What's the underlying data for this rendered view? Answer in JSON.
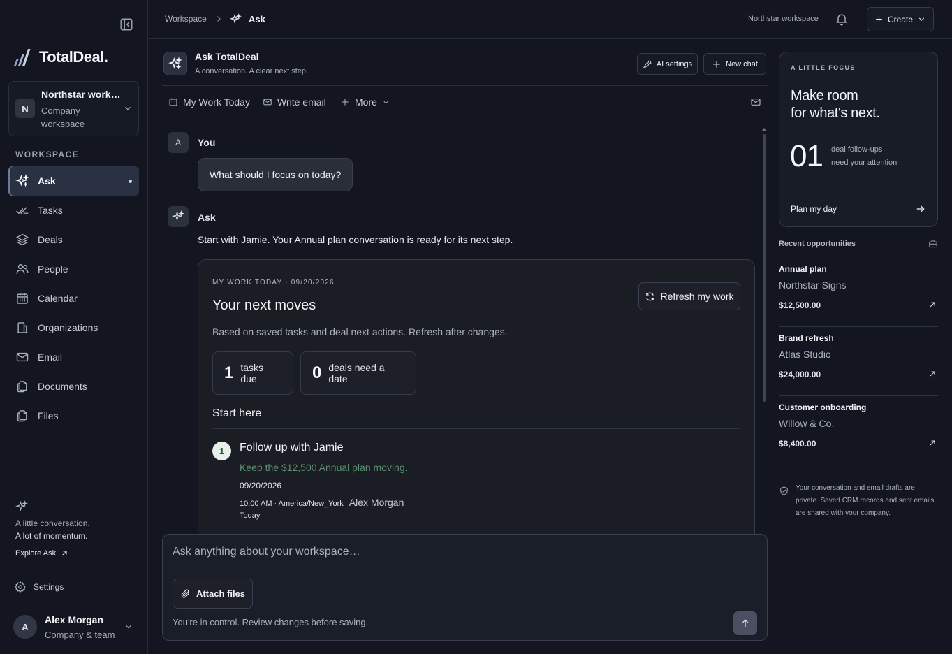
{
  "sidebar": {
    "brand": "TotalDeal.",
    "workspace": {
      "initial": "N",
      "name": "Northstar workspace",
      "type": "Company workspace"
    },
    "section_label": "WORKSPACE",
    "items": [
      {
        "label": "Ask",
        "icon": "sparkle-icon",
        "active": true
      },
      {
        "label": "Tasks",
        "icon": "double-check-icon"
      },
      {
        "label": "Deals",
        "icon": "layers-icon"
      },
      {
        "label": "People",
        "icon": "people-icon"
      },
      {
        "label": "Calendar",
        "icon": "calendar-icon"
      },
      {
        "label": "Organizations",
        "icon": "building-icon"
      },
      {
        "label": "Email",
        "icon": "mail-icon"
      },
      {
        "label": "Documents",
        "icon": "documents-icon"
      },
      {
        "label": "Files",
        "icon": "files-icon"
      }
    ],
    "promo": {
      "line1": "A little conversation.",
      "line2": "A lot of momentum.",
      "link": "Explore Ask"
    },
    "settings_label": "Settings",
    "user": {
      "initial": "A",
      "name": "Alex Morgan",
      "team": "Company & team"
    }
  },
  "topbar": {
    "breadcrumb_root": "Workspace",
    "breadcrumb_current": "Ask",
    "workspace_label": "Northstar workspace",
    "create_label": "Create"
  },
  "header": {
    "title": "Ask TotalDeal",
    "subtitle": "A conversation. A clear next step.",
    "ai_settings_label": "AI settings",
    "new_chat_label": "New chat"
  },
  "tabs": [
    {
      "label": "My Work Today",
      "icon": "calendar-icon"
    },
    {
      "label": "Write email",
      "icon": "mail-icon"
    },
    {
      "label": "More",
      "icon": "plus-icon"
    }
  ],
  "chat": {
    "user_initial": "A",
    "user_author": "You",
    "user_message": "What should I focus on today?",
    "assistant_author": "Ask",
    "assistant_message": "Start with Jamie. Your Annual plan conversation is ready for its next step.",
    "card": {
      "kicker": "MY WORK TODAY · 09/20/2026",
      "title": "Your next moves",
      "refresh_label": "Refresh my work",
      "description": "Based on saved tasks and deal next actions. Refresh after changes.",
      "stats": [
        {
          "value": "1",
          "label": "tasks due"
        },
        {
          "value": "0",
          "label": "deals need a date"
        }
      ],
      "start_here": "Start here",
      "step": {
        "number": "1",
        "title": "Follow up with Jamie",
        "subtitle": "Keep the $12,500 Annual plan moving.",
        "date": "09/20/2026",
        "time": "10:00 AM · America/New_York",
        "owner": "Alex Morgan",
        "when": "Today"
      }
    }
  },
  "composer": {
    "placeholder": "Ask anything about your workspace…",
    "attach_label": "Attach files",
    "note": "You're in control. Review changes before saving."
  },
  "focus": {
    "kicker": "A LITTLE FOCUS",
    "headline1": "Make room",
    "headline2": "for what's next.",
    "count": "01",
    "desc1": "deal follow-ups",
    "desc2": "need your attention",
    "action": "Plan my day"
  },
  "recent": {
    "title": "Recent opportunities",
    "items": [
      {
        "name": "Annual plan",
        "company": "Northstar Signs",
        "amount": "$12,500.00"
      },
      {
        "name": "Brand refresh",
        "company": "Atlas Studio",
        "amount": "$24,000.00"
      },
      {
        "name": "Customer onboarding",
        "company": "Willow & Co.",
        "amount": "$8,400.00"
      }
    ]
  },
  "privacy_note": "Your conversation and email drafts are private. Saved CRM records and sent emails are shared with your company."
}
